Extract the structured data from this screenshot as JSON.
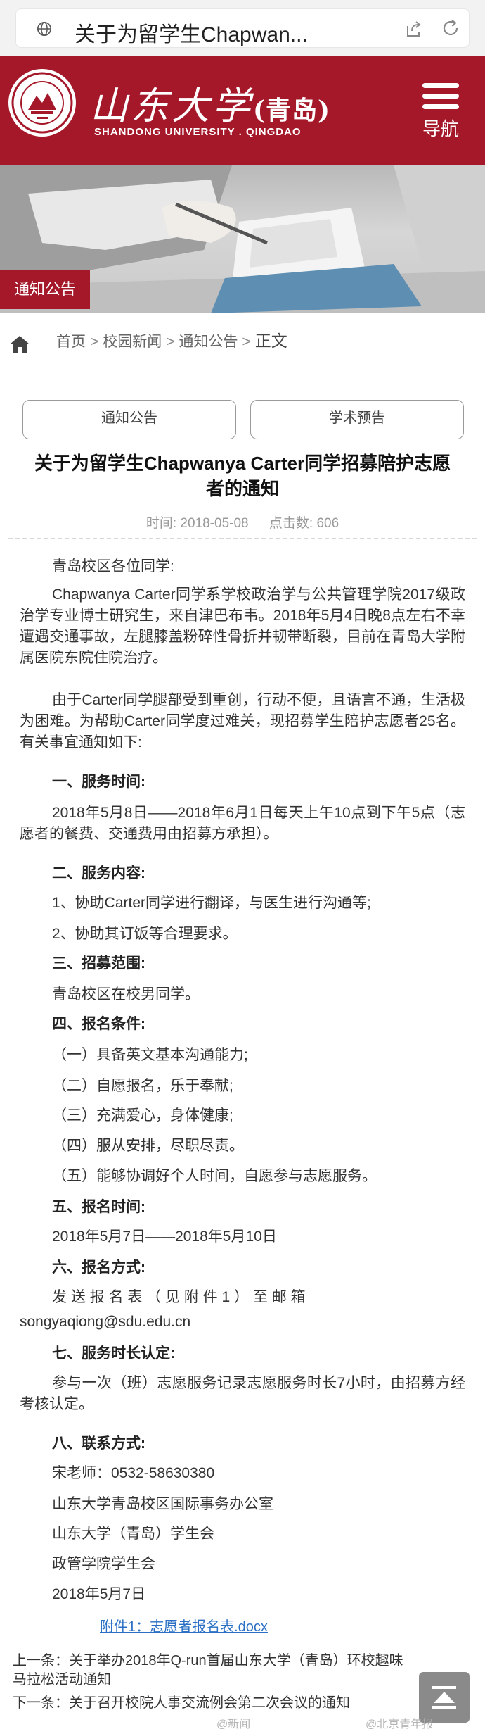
{
  "browser": {
    "address_text": "关于为留学生Chapwan..."
  },
  "header": {
    "brand_cn": "山东大学",
    "brand_cn_suffix": "(青岛)",
    "brand_en": "SHANDONG UNIVERSITY . QINGDAO",
    "nav_label": "导航",
    "brand_color": "#a5182a"
  },
  "banner": {
    "tag": "通知公告"
  },
  "breadcrumb": {
    "items": [
      "首页",
      "校园新闻",
      "通知公告"
    ],
    "separator": ">",
    "current": "正文"
  },
  "tabs": [
    {
      "label": "通知公告"
    },
    {
      "label": "学术预告"
    }
  ],
  "article": {
    "title_line1": "关于为留学生Chapwanya Carter同学招募陪护志愿",
    "title_line2": "者的通知",
    "time_label": "时间:",
    "time_value": "2018-05-08",
    "views_label": "点击数:",
    "views_value": "606",
    "greeting": "青岛校区各位同学:",
    "p1": "Chapwanya Carter同学系学校政治学与公共管理学院2017级政治学专业博士研究生，来自津巴布韦。2018年5月4日晚8点左右不幸遭遇交通事故，左腿膝盖粉碎性骨折并韧带断裂，目前在青岛大学附属医院东院住院治疗。",
    "p2": "由于Carter同学腿部受到重创，行动不便，且语言不通，生活极为困难。为帮助Carter同学度过难关，现招募学生陪护志愿者25名。有关事宜通知如下:",
    "h1": "一、服务时间:",
    "s1": "2018年5月8日——2018年6月1日每天上午10点到下午5点（志愿者的餐费、交通费用由招募方承担）。",
    "h2": "二、服务内容:",
    "s2_1": "1、协助Carter同学进行翻译，与医生进行沟通等;",
    "s2_2": "2、协助其订饭等合理要求。",
    "h3": "三、招募范围:",
    "s3": "青岛校区在校男同学。",
    "h4": "四、报名条件:",
    "s4": [
      "（一）具备英文基本沟通能力;",
      "（二）自愿报名，乐于奉献;",
      "（三）充满爱心，身体健康;",
      "（四）服从安排，尽职尽责。",
      "（五）能够协调好个人时间，自愿参与志愿服务。"
    ],
    "h5": "五、报名时间:",
    "s5": "2018年5月7日——2018年5月10日",
    "h6": "六、报名方式:",
    "s6_line1": "发 送 报 名 表 （ 见 附 件 1 ） 至 邮 箱",
    "s6_email": "songyaqiong@sdu.edu.cn",
    "h7": "七、服务时长认定:",
    "s7": "参与一次（班）志愿服务记录志愿服务时长7小时，由招募方经考核认定。",
    "h8": "八、联系方式:",
    "s8": [
      "宋老师：0532-58630380",
      "山东大学青岛校区国际事务办公室",
      "山东大学（青岛）学生会",
      "政管学院学生会",
      "2018年5月7日"
    ],
    "attachment": "附件1：志愿者报名表.docx"
  },
  "pager": {
    "prev_label": "上一条：",
    "prev_text": "关于举办2018年Q-run首届山东大学（青岛）环校趣味马拉松活动通知",
    "next_label": "下一条：",
    "next_text": "关于召开校院人事交流例会第二次会议的通知"
  },
  "watermarks": [
    "@新闻",
    "@北京青年报"
  ]
}
